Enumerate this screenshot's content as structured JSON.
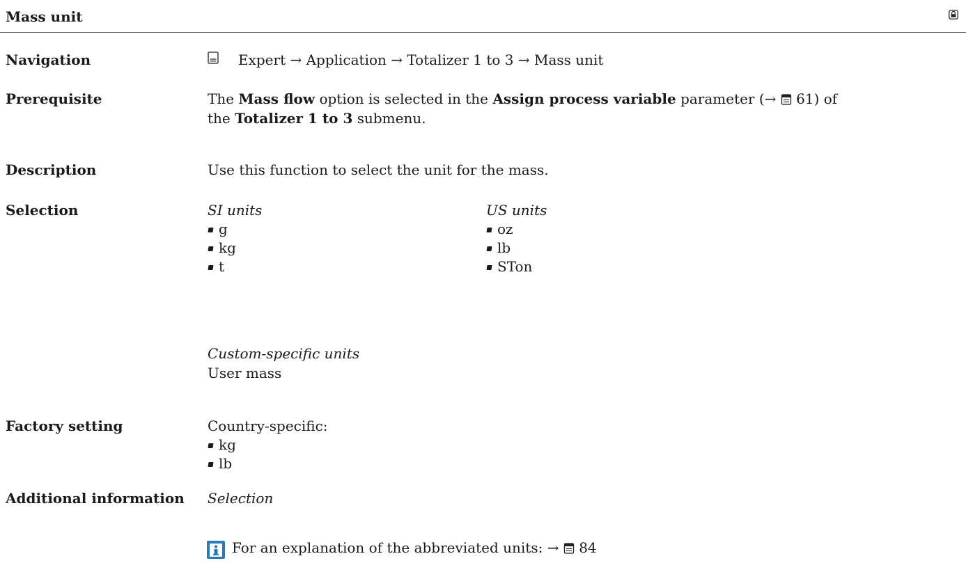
{
  "header": {
    "title": "Mass unit"
  },
  "navigation": {
    "label": "Navigation",
    "path": "Expert → Application → Totalizer 1 to 3 → Mass unit"
  },
  "prerequisite": {
    "label": "Prerequisite",
    "t1": "The ",
    "b1": "Mass flow",
    "t2": " option is selected in the ",
    "b2": "Assign process variable",
    "t3": " parameter (→ ",
    "page_ref": "61",
    "t4": ") of",
    "t5": "the ",
    "b3": "Totalizer 1 to 3",
    "t6": " submenu."
  },
  "description": {
    "label": "Description",
    "text": "Use this function to select the unit for the mass."
  },
  "selection": {
    "label": "Selection",
    "si_heading": "SI units",
    "si_items": [
      "g",
      "kg",
      "t"
    ],
    "us_heading": "US units",
    "us_items": [
      "oz",
      "lb",
      "STon"
    ],
    "custom_heading": "Custom-specific units",
    "custom_value": "User mass"
  },
  "factory_setting": {
    "label": "Factory setting",
    "intro": "Country-specific:",
    "items": [
      "kg",
      "lb"
    ]
  },
  "additional_information": {
    "label": "Additional information",
    "subheading": "Selection",
    "note_text": "For an explanation of the abbreviated units: → ",
    "note_ref": "84"
  }
}
